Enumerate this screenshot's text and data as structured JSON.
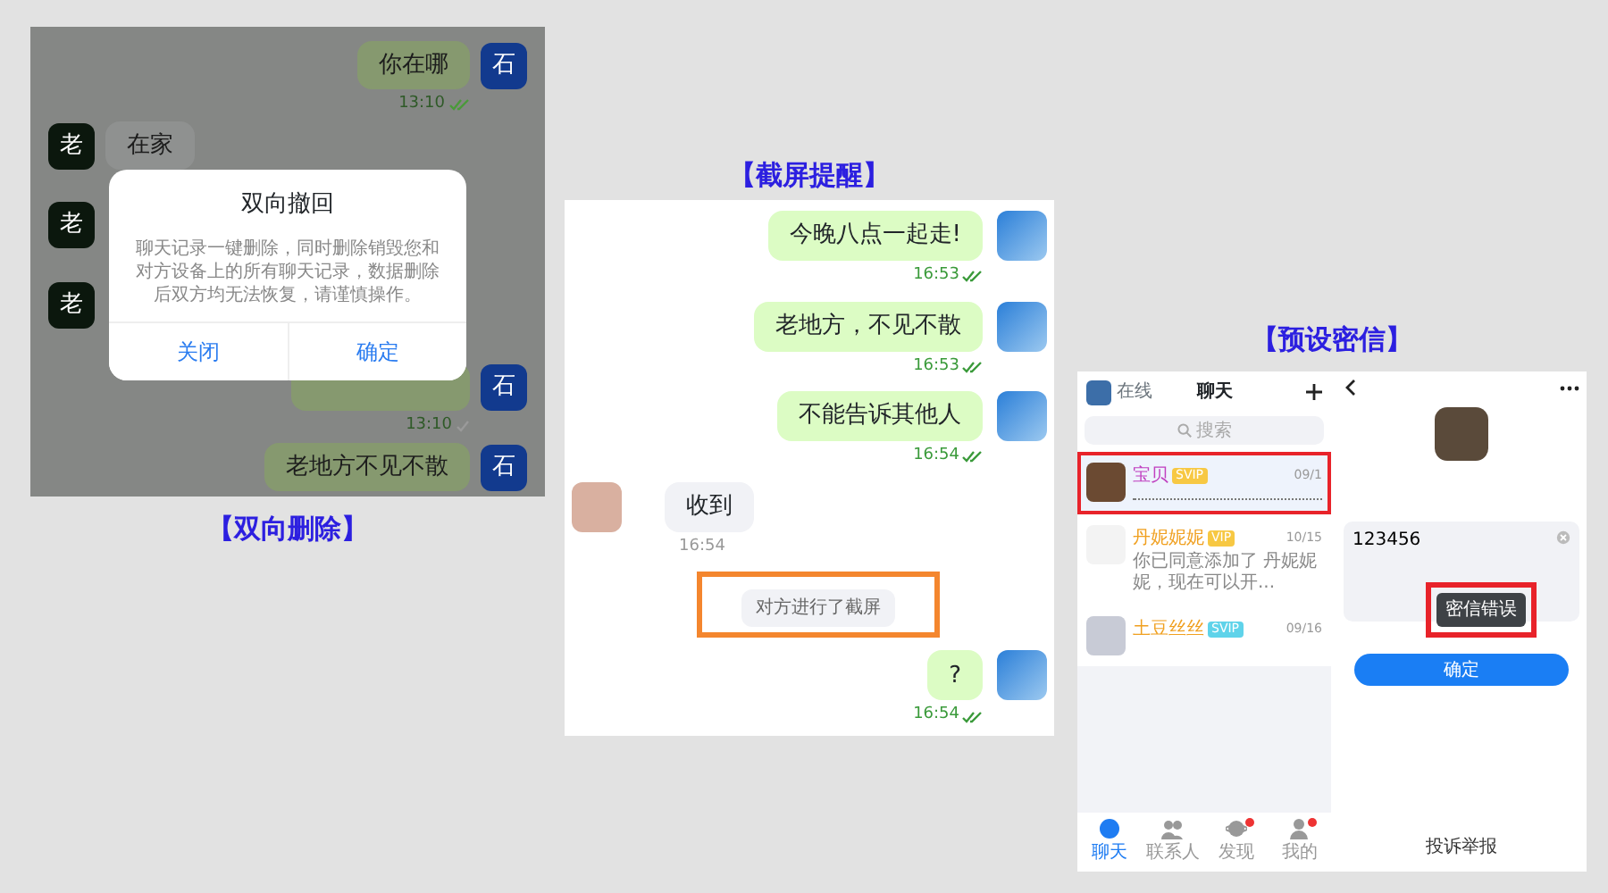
{
  "recall_demo": {
    "caption": "【双向删除】",
    "messages": [
      {
        "kind": "sent",
        "avatar": "石",
        "text": "你在哪",
        "time": "13:10",
        "read": true
      },
      {
        "kind": "received",
        "avatar": "老",
        "text": "在家"
      },
      {
        "kind": "received",
        "avatar": "老"
      },
      {
        "kind": "received",
        "avatar": "老"
      },
      {
        "kind": "sent",
        "avatar": "石",
        "time": "13:10",
        "read": false
      },
      {
        "kind": "sent",
        "avatar": "石",
        "text": "老地方不见不散"
      }
    ],
    "dialog": {
      "title": "双向撤回",
      "body": "聊天记录一键删除，同时删除销毁您和对方设备上的所有聊天记录，数据删除后双方均无法恢复，请谨慎操作。",
      "buttons": [
        "关闭",
        "确定"
      ]
    }
  },
  "screenshot_demo": {
    "caption": "【截屏提醒】",
    "items": [
      {
        "kind": "sent",
        "text": "今晚八点一起走!",
        "time": "16:53",
        "read": true
      },
      {
        "kind": "sent",
        "text": "老地方，不见不散",
        "time": "16:53",
        "read": true
      },
      {
        "kind": "sent",
        "text": "不能告诉其他人",
        "time": "16:54",
        "read": true
      },
      {
        "kind": "received",
        "text": "收到",
        "time": "16:54"
      },
      {
        "kind": "notice",
        "text": "对方进行了截屏",
        "highlighted": true
      },
      {
        "kind": "sent",
        "text": "?",
        "time": "16:54",
        "read": true
      }
    ]
  },
  "preset_demo": {
    "caption": "【预设密信】",
    "list": {
      "status": "在线",
      "title": "聊天",
      "search": {
        "placeholder": "搜索"
      },
      "chats": [
        {
          "name": "宝贝",
          "color": "#c040c0",
          "badge": "SVIP",
          "time": "09/1",
          "preview_masked": true,
          "selected": true,
          "highlighted": true
        },
        {
          "name": "丹妮妮妮",
          "color": "#f0a020",
          "badge": "VIP",
          "time": "10/15",
          "preview": "你已同意添加了 丹妮妮妮，现在可以开...",
          "selected": false,
          "highlighted": false
        },
        {
          "name": "土豆丝丝",
          "color": "#f0a020",
          "badge": "SVIP",
          "time": "09/16",
          "selected": false,
          "highlighted": false
        }
      ],
      "nav": [
        {
          "label": "聊天",
          "selected": true,
          "dot": false
        },
        {
          "label": "联系人",
          "selected": false,
          "dot": false
        },
        {
          "label": "发现",
          "selected": false,
          "dot": true
        },
        {
          "label": "我的",
          "selected": false,
          "dot": true
        }
      ]
    },
    "detail": {
      "field": {
        "value": "123456"
      },
      "toast": {
        "text": "密信错误",
        "highlighted": true
      },
      "confirm": "确定",
      "footer": "投诉举报"
    }
  }
}
